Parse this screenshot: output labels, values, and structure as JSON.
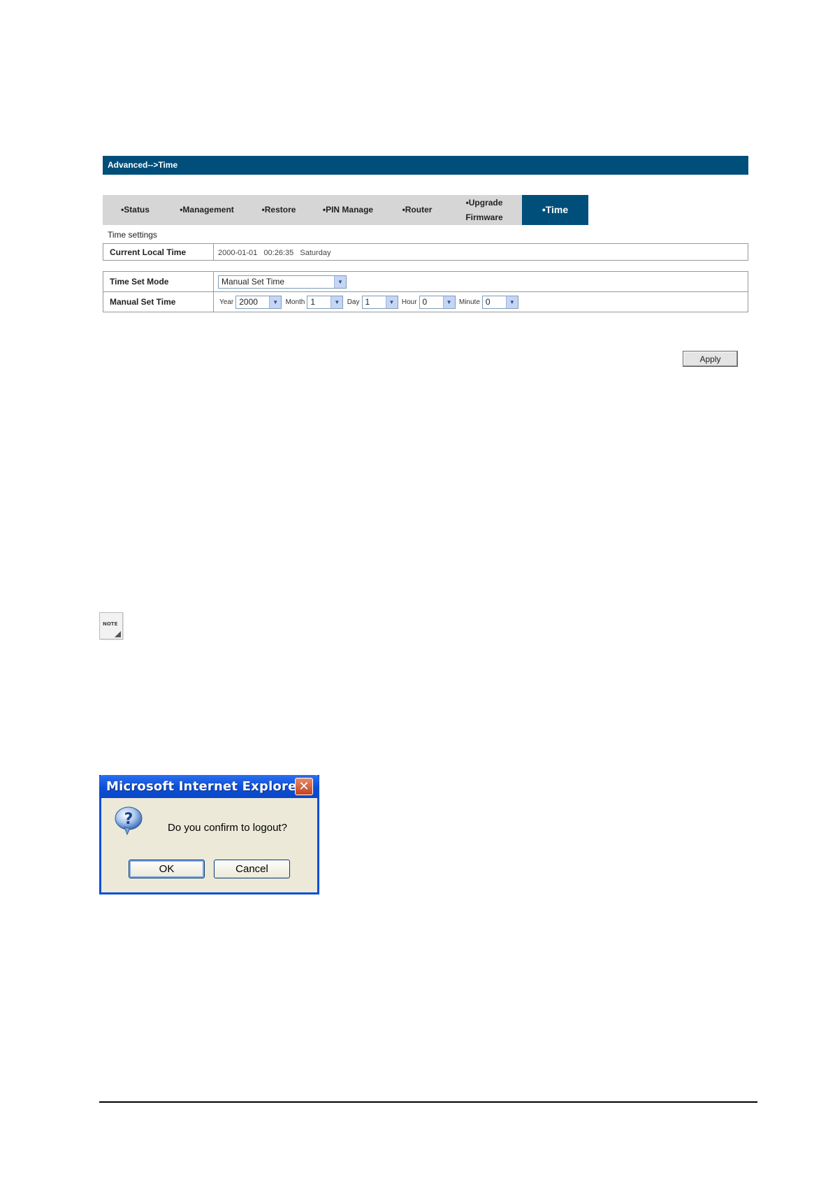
{
  "header": {
    "breadcrumb": "Advanced-->Time"
  },
  "tabs": [
    {
      "label": "•Status"
    },
    {
      "label": "•Management"
    },
    {
      "label": "•Restore"
    },
    {
      "label": "•PIN Manage"
    },
    {
      "label": "•Router"
    },
    {
      "label": "•Upgrade Firmware"
    },
    {
      "label": "•Time",
      "active": true
    }
  ],
  "time_settings": {
    "section_label": "Time settings",
    "current_local_time": {
      "label": "Current Local Time",
      "value": "2000-01-01   00:26:35   Saturday"
    },
    "time_set_mode": {
      "label": "Time Set Mode",
      "value": "Manual Set Time"
    },
    "manual_set_time": {
      "label": "Manual Set Time",
      "year": {
        "label": "Year",
        "value": "2000"
      },
      "month": {
        "label": "Month",
        "value": "1"
      },
      "day": {
        "label": "Day",
        "value": "1"
      },
      "hour": {
        "label": "Hour",
        "value": "0"
      },
      "minute": {
        "label": "Minute",
        "value": "0"
      }
    },
    "apply_label": "Apply"
  },
  "note_icon": {
    "text": "NOTE",
    "icon": "note-icon"
  },
  "dialog": {
    "title": "Microsoft Internet Explorer",
    "close": "✕",
    "message": "Do you confirm to logout?",
    "ok_label": "OK",
    "cancel_label": "Cancel"
  },
  "colors": {
    "accent": "#004f7b",
    "tab_bar": "#d6d6d6",
    "dialog_title": "#0c4fd6"
  }
}
